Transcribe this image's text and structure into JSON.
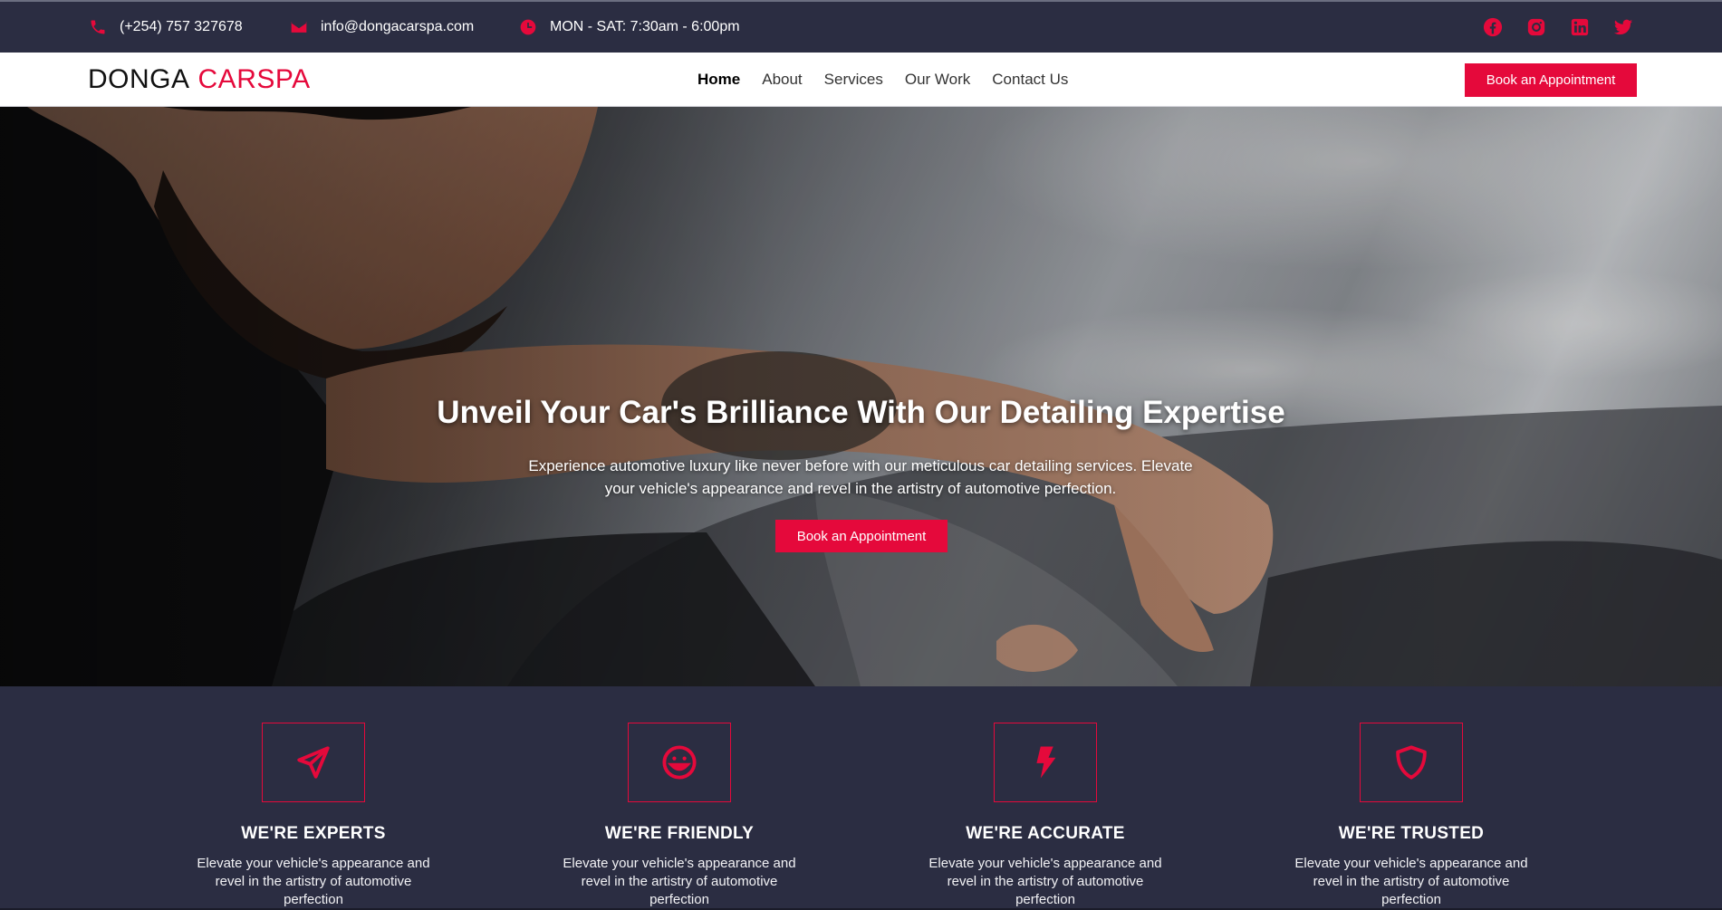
{
  "topbar": {
    "phone": "(+254) 757 327678",
    "email": "info@dongacarspa.com",
    "hours": "MON - SAT: 7:30am - 6:00pm",
    "social": [
      "facebook-icon",
      "instagram-icon",
      "linkedin-icon",
      "twitter-icon"
    ]
  },
  "nav": {
    "logo_primary": "DONGA",
    "logo_accent": "CARSPA",
    "items": [
      {
        "label": "Home",
        "active": true
      },
      {
        "label": "About"
      },
      {
        "label": "Services"
      },
      {
        "label": "Our Work"
      },
      {
        "label": "Contact Us"
      }
    ],
    "cta": "Book an Appointment"
  },
  "hero": {
    "title": "Unveil Your Car's Brilliance With Our Detailing Expertise",
    "subtitle": "Experience automotive luxury like never before with our meticulous car detailing services. Elevate your vehicle's appearance and revel in the artistry of automotive perfection.",
    "cta": "Book an Appointment"
  },
  "features": [
    {
      "icon": "paper-plane-icon",
      "title": "WE'RE EXPERTS",
      "text": "Elevate your vehicle's appearance and revel in the artistry of automotive perfection"
    },
    {
      "icon": "smile-icon",
      "title": "WE'RE FRIENDLY",
      "text": "Elevate your vehicle's appearance and revel in the artistry of automotive perfection"
    },
    {
      "icon": "lightning-icon",
      "title": "WE'RE ACCURATE",
      "text": "Elevate your vehicle's appearance and revel in the artistry of automotive perfection"
    },
    {
      "icon": "shield-icon",
      "title": "WE'RE TRUSTED",
      "text": "Elevate your vehicle's appearance and revel in the artistry of automotive perfection"
    }
  ],
  "colors": {
    "accent": "#e5093b",
    "dark": "#2b2d42",
    "white": "#ffffff"
  }
}
